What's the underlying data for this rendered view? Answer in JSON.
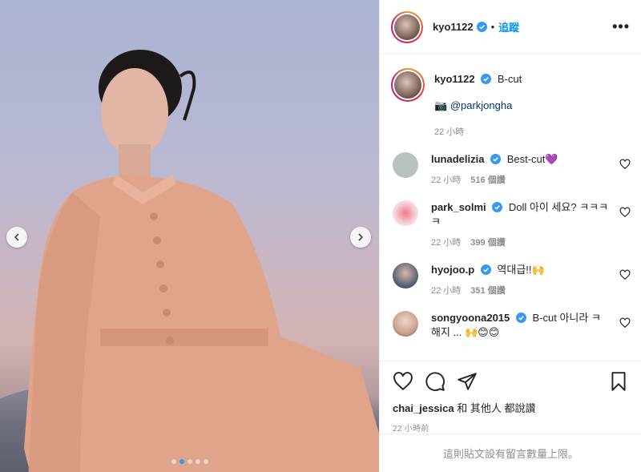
{
  "post": {
    "author": "kyo1122",
    "separator": "•",
    "follow_label": "追蹤",
    "more_label": "•••",
    "caption": {
      "user": "kyo1122",
      "text": "B-cut",
      "camera_emoji": "📷",
      "mention": "@parkjongha",
      "time": "22 小時"
    },
    "carousel": {
      "total_slides": 5,
      "active_index": 1
    }
  },
  "comments": [
    {
      "user": "lunadelizia",
      "text": "Best-cut💜",
      "time": "22 小時",
      "likes": "516 個讚",
      "avatar_color": "#b8c3c0"
    },
    {
      "user": "park_solmi",
      "text": "Doll 아이 세요? ㅋㅋㅋㅋ",
      "time": "22 小時",
      "likes": "399 個讚",
      "avatar_color": "#f3d3da"
    },
    {
      "user": "hyojoo.p",
      "text": "역대급!!🙌",
      "time": "22 小時",
      "likes": "351 個讚",
      "avatar_color": "#4b5a6e"
    },
    {
      "user": "songyoona2015",
      "text": "B-cut 아니라 ㅋ 해지 ... 🙌😊😊",
      "time": "",
      "likes": "",
      "avatar_color": "#c9a28e"
    }
  ],
  "footer": {
    "liked_by_user": "chai_jessica",
    "liked_by_suffix": " 和 其他人 都說讚",
    "time_ago": "22 小時前",
    "comments_limit": "這則貼文設有留言數量上限。"
  },
  "colors": {
    "link": "#0095f6",
    "verified": "#3897f0",
    "muted": "#8e8e8e"
  }
}
